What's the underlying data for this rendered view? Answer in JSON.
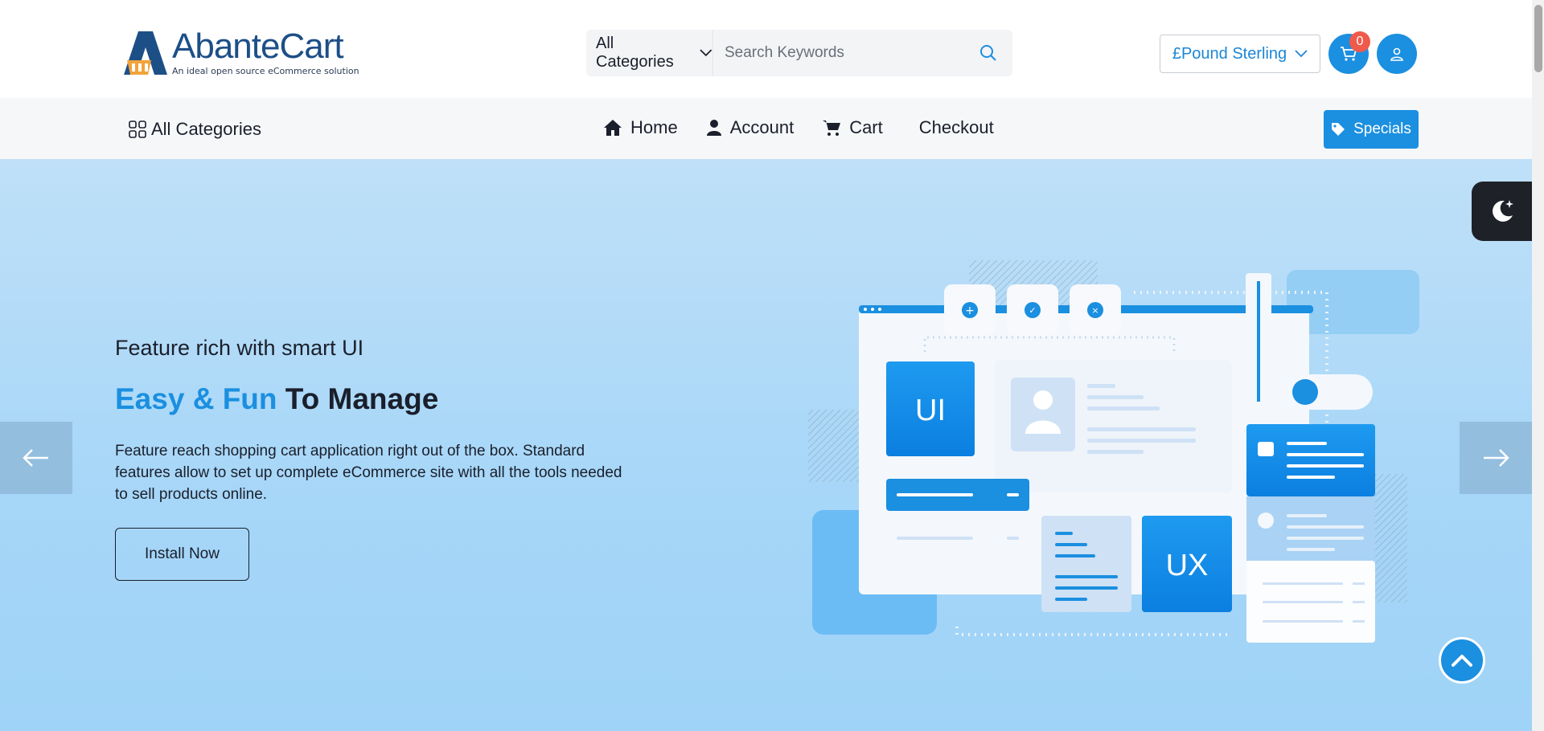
{
  "header": {
    "logo_name": "AbanteCart",
    "logo_tagline": "An ideal open source eCommerce solution",
    "search": {
      "category": "All Categories",
      "placeholder": "Search Keywords"
    },
    "currency": "£Pound Sterling",
    "cart_count": "0"
  },
  "nav": {
    "all_categories": "All Categories",
    "links": [
      {
        "label": "Home",
        "icon": "home-icon"
      },
      {
        "label": "Account",
        "icon": "user-icon"
      },
      {
        "label": "Cart",
        "icon": "cart-icon"
      },
      {
        "label": "Checkout",
        "icon": ""
      }
    ],
    "specials": "Specials"
  },
  "hero": {
    "subtitle": "Feature rich with smart UI",
    "title_accent": "Easy & Fun",
    "title_rest": " To Manage",
    "description": "Feature reach shopping cart application right out of the box. Standard features allow to set up complete eCommerce site with all the tools needed to sell products online.",
    "button": "Install Now",
    "illustration_labels": {
      "ui": "UI",
      "ux": "UX"
    }
  },
  "colors": {
    "accent": "#1b8fe0",
    "badge": "#ef5a4c",
    "hero_bg": "#a6d6f8"
  }
}
